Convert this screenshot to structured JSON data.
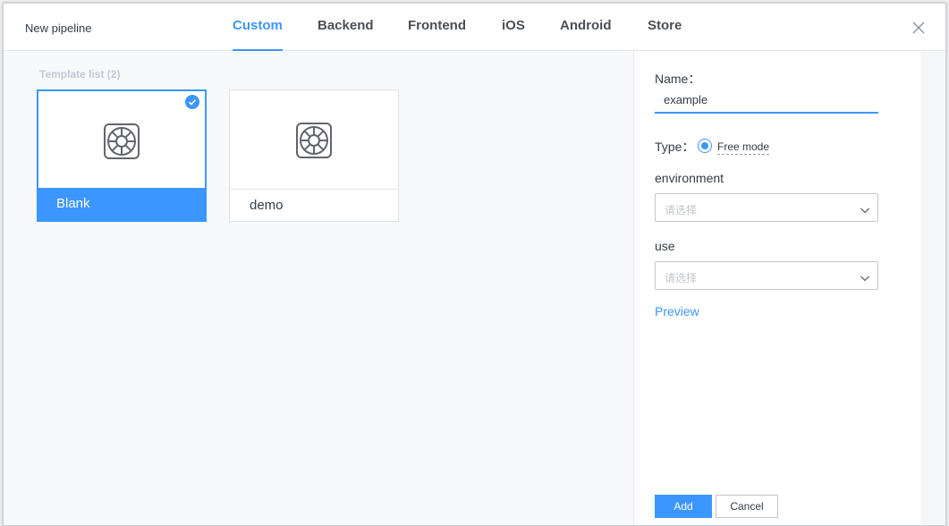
{
  "header": {
    "title": "New pipeline",
    "tabs": [
      {
        "label": "Custom",
        "active": true
      },
      {
        "label": "Backend",
        "active": false
      },
      {
        "label": "Frontend",
        "active": false
      },
      {
        "label": "iOS",
        "active": false
      },
      {
        "label": "Android",
        "active": false
      },
      {
        "label": "Store",
        "active": false
      }
    ]
  },
  "templates": {
    "label": "Template list  (2)",
    "items": [
      {
        "name": "Blank",
        "selected": true,
        "icon": "pipeline-wheel-icon"
      },
      {
        "name": "demo",
        "selected": false,
        "icon": "pipeline-wheel-icon"
      }
    ]
  },
  "form": {
    "name_label": "Name：",
    "name_value": "example",
    "type_label": "Type：",
    "type_option": "Free mode",
    "environment_label": "environment",
    "environment_placeholder": "请选择",
    "use_label": "use",
    "use_placeholder": "请选择",
    "preview_label": "Preview",
    "add_label": "Add",
    "cancel_label": "Cancel"
  },
  "colors": {
    "accent": "#3c96ff",
    "text": "#333c48",
    "muted": "#c2c9d6"
  }
}
